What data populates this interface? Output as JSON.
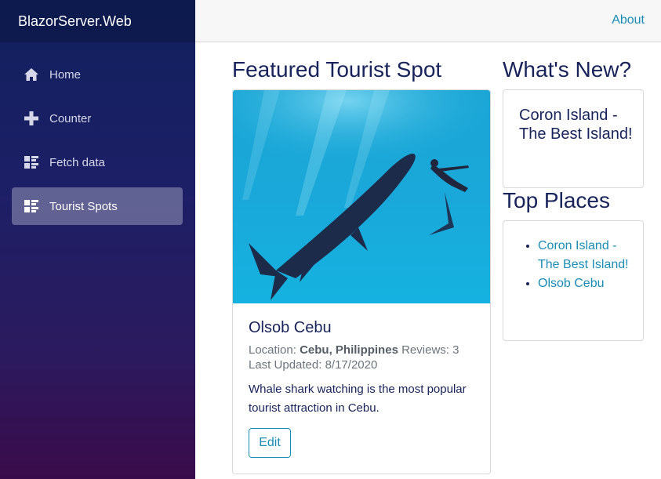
{
  "app": {
    "brand": "BlazorServer.Web"
  },
  "sidebar": {
    "items": [
      {
        "label": "Home",
        "icon": "home-icon",
        "active": false
      },
      {
        "label": "Counter",
        "icon": "plus-icon",
        "active": false
      },
      {
        "label": "Fetch data",
        "icon": "list-rich-icon",
        "active": false
      },
      {
        "label": "Tourist Spots",
        "icon": "list-rich-icon",
        "active": true
      }
    ]
  },
  "topbar": {
    "about": "About"
  },
  "featured": {
    "title": "Featured Tourist Spot",
    "spot": {
      "name": "Olsob Cebu",
      "location_label": "Location:",
      "location": "Cebu, Philippines",
      "reviews_label": "Reviews:",
      "reviews": "3",
      "updated_label": "Last Updated:",
      "updated": "8/17/2020",
      "description": "Whale shark watching is the most popular tourist attraction in Cebu.",
      "edit_label": "Edit"
    }
  },
  "whats_new": {
    "title": "What's New?",
    "headline": "Coron Island - The Best Island!"
  },
  "top_places": {
    "title": "Top Places",
    "items": [
      "Coron Island - The Best Island!",
      "Olsob Cebu"
    ]
  },
  "colors": {
    "accent": "#1b8cb5",
    "heading": "#17235a",
    "sidebar_top": "#10205e",
    "sidebar_bottom": "#3a0b4a"
  }
}
